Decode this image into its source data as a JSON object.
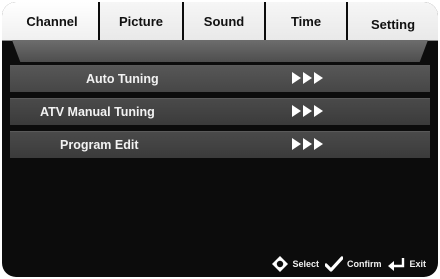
{
  "tabs": [
    {
      "label": "Channel",
      "active": true
    },
    {
      "label": "Picture",
      "active": false
    },
    {
      "label": "Sound",
      "active": false
    },
    {
      "label": "Time",
      "active": false
    },
    {
      "label": "Setting",
      "active": false
    }
  ],
  "menu": {
    "items": [
      {
        "label": "Auto Tuning",
        "icon": "triple-arrow-right-icon"
      },
      {
        "label": "ATV Manual Tuning",
        "icon": "triple-arrow-right-icon"
      },
      {
        "label": "Program Edit",
        "icon": "triple-arrow-right-icon"
      }
    ]
  },
  "hints": {
    "select": {
      "label": "Select",
      "icon": "dpad-icon"
    },
    "confirm": {
      "label": "Confirm",
      "icon": "checkmark-icon"
    },
    "exit": {
      "label": "Exit",
      "icon": "return-arrow-icon"
    }
  },
  "colors": {
    "background": "#0c0c0c",
    "tab_bg": "#f2f2f2",
    "row_bg": "#444444",
    "text": "#f2f2f2"
  }
}
